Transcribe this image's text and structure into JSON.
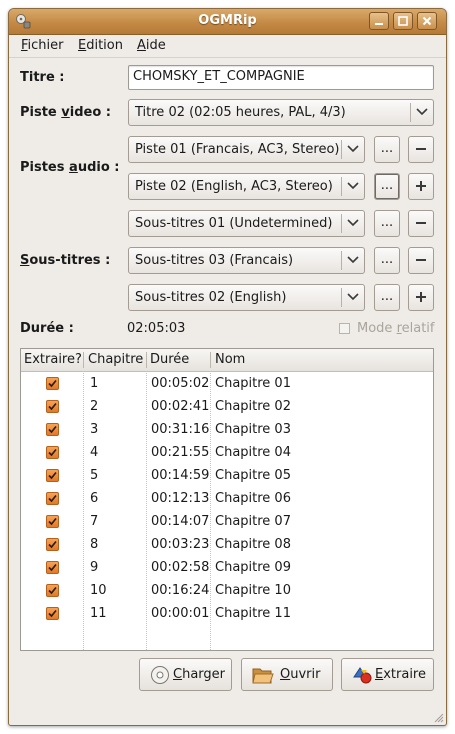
{
  "window": {
    "title": "OGMRip"
  },
  "menu": {
    "items": [
      {
        "accel": "F",
        "rest": "ichier"
      },
      {
        "accel": "E",
        "rest": "dition"
      },
      {
        "accel": "A",
        "rest": "ide"
      }
    ]
  },
  "form": {
    "title_label": "Titre :",
    "title_value": "CHOMSKY_ET_COMPAGNIE",
    "video_label_pre": "Piste ",
    "video_label_accel": "v",
    "video_label_post": "ideo :",
    "video_value": "Titre 02 (02:05 heures, PAL, 4/3)",
    "audio_label_pre": "Pistes ",
    "audio_label_accel": "a",
    "audio_label_post": "udio :",
    "audio_tracks": [
      {
        "value": "Piste 01 (Francais, AC3, Stereo)",
        "more": "...",
        "action": "remove"
      },
      {
        "value": "Piste 02 (English, AC3, Stereo)",
        "more": "...",
        "action": "add"
      }
    ],
    "subs_label_accel": "S",
    "subs_label_post": "ous-titres :",
    "subtitle_tracks": [
      {
        "value": "Sous-titres 01 (Undetermined)",
        "more": "...",
        "action": "remove"
      },
      {
        "value": "Sous-titres 03 (Francais)",
        "more": "...",
        "action": "remove"
      },
      {
        "value": "Sous-titres 02 (English)",
        "more": "...",
        "action": "add"
      }
    ],
    "duration_label": "Durée :",
    "duration_value": "02:05:03",
    "relative_mode_pre": "Mode ",
    "relative_mode_accel": "r",
    "relative_mode_post": "elatif",
    "relative_mode_checked": false
  },
  "chapters": {
    "columns": [
      "Extraire?",
      "Chapitre",
      "Durée",
      "Nom"
    ],
    "rows": [
      {
        "extract": true,
        "num": "1",
        "duration": "00:05:02",
        "name": "Chapitre 01"
      },
      {
        "extract": true,
        "num": "2",
        "duration": "00:02:41",
        "name": "Chapitre 02"
      },
      {
        "extract": true,
        "num": "3",
        "duration": "00:31:16",
        "name": "Chapitre 03"
      },
      {
        "extract": true,
        "num": "4",
        "duration": "00:21:55",
        "name": "Chapitre 04"
      },
      {
        "extract": true,
        "num": "5",
        "duration": "00:14:59",
        "name": "Chapitre 05"
      },
      {
        "extract": true,
        "num": "6",
        "duration": "00:12:13",
        "name": "Chapitre 06"
      },
      {
        "extract": true,
        "num": "7",
        "duration": "00:14:07",
        "name": "Chapitre 07"
      },
      {
        "extract": true,
        "num": "8",
        "duration": "00:03:23",
        "name": "Chapitre 08"
      },
      {
        "extract": true,
        "num": "9",
        "duration": "00:02:58",
        "name": "Chapitre 09"
      },
      {
        "extract": true,
        "num": "10",
        "duration": "00:16:24",
        "name": "Chapitre 10"
      },
      {
        "extract": true,
        "num": "11",
        "duration": "00:00:01",
        "name": "Chapitre 11"
      }
    ]
  },
  "buttons": {
    "load": {
      "accel": "C",
      "rest": "harger"
    },
    "open": {
      "accel": "O",
      "rest": "uvrir"
    },
    "extract": {
      "accel": "E",
      "rest": "xtraire"
    }
  },
  "colors": {
    "titlebar": "#c48a45",
    "checkbox": "#e3782a",
    "window_bg": "#efebe7"
  }
}
